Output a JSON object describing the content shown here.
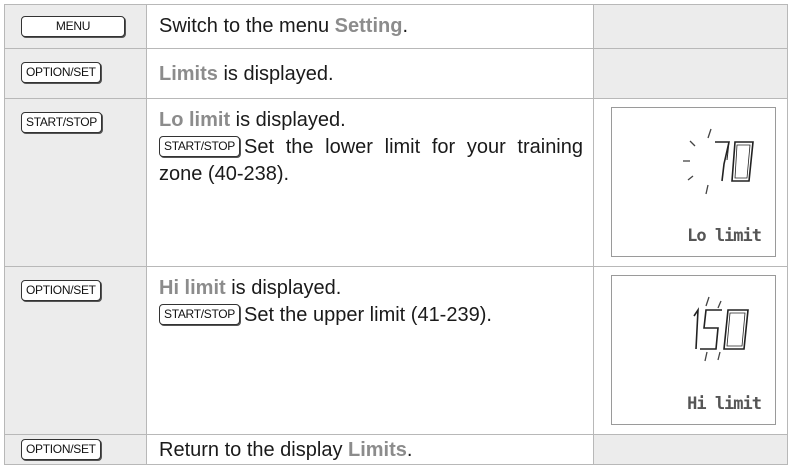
{
  "rows": [
    {
      "key": "MENU",
      "desc_pre": "Switch to the menu ",
      "desc_hl": "Setting",
      "desc_post": "."
    },
    {
      "key": "OPTION/SET",
      "desc_hl": "Limits",
      "desc_post": " is displayed."
    },
    {
      "key": "START/STOP",
      "desc_hl": "Lo limit",
      "desc_post": " is displayed.",
      "inline_key": "START/STOP",
      "detail": "Set the lower limit for your training zone (40-238).",
      "display_value": "70",
      "display_label": "Lo limit"
    },
    {
      "key": "OPTION/SET",
      "desc_hl": "Hi limit",
      "desc_post": " is displayed.",
      "inline_key": "START/STOP",
      "detail": "Set the upper limit (41-239).",
      "display_value": "150",
      "display_label": "Hi limit"
    },
    {
      "key": "OPTION/SET",
      "desc_pre": "Return to the display ",
      "desc_hl": "Limits",
      "desc_post": "."
    }
  ]
}
